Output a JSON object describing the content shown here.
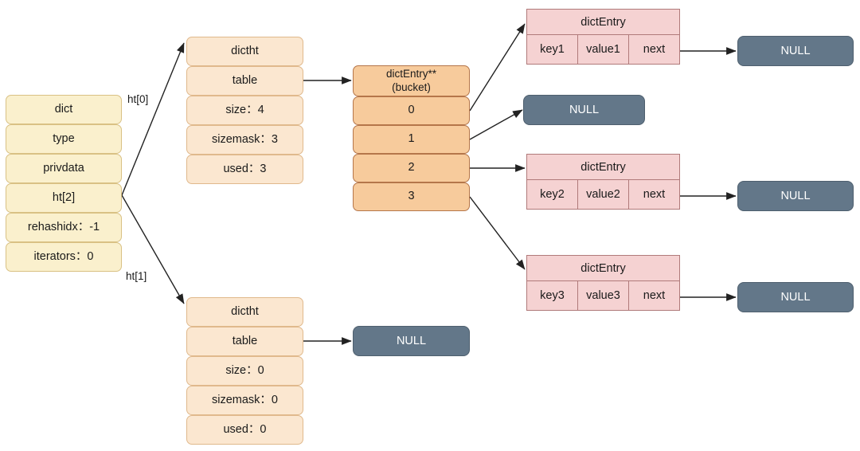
{
  "diagram": {
    "title": "Redis dict / dictht / dictEntry structure",
    "colors": {
      "dict_fill": "#FAF0CD",
      "dictht_fill": "#FBE7D0",
      "bucket_fill": "#F7CB9C",
      "dictentry_fill": "#F5D2D2",
      "null_fill": "#637789",
      "background": "#FFFFFF",
      "edge": "#333333"
    }
  },
  "dict": {
    "rows": [
      {
        "label": "dict"
      },
      {
        "label": "type"
      },
      {
        "label": "privdata"
      },
      {
        "label": "ht[2]"
      },
      {
        "label": "rehashidx：-1"
      },
      {
        "label": "iterators：0"
      }
    ]
  },
  "edge_labels": {
    "ht0": "ht[0]",
    "ht1": "ht[1]"
  },
  "dictht0": {
    "rows": [
      {
        "label": "dictht"
      },
      {
        "label": "table"
      },
      {
        "label": "size：4"
      },
      {
        "label": "sizemask：3"
      },
      {
        "label": "used：3"
      }
    ]
  },
  "dictht1": {
    "rows": [
      {
        "label": "dictht"
      },
      {
        "label": "table"
      },
      {
        "label": "size：0"
      },
      {
        "label": "sizemask：0"
      },
      {
        "label": "used：0"
      }
    ]
  },
  "bucket": {
    "header_line1": "dictEntry**",
    "header_line2": "(bucket)",
    "slots": [
      {
        "label": "0"
      },
      {
        "label": "1"
      },
      {
        "label": "2"
      },
      {
        "label": "3"
      }
    ]
  },
  "entries": [
    {
      "header": "dictEntry",
      "key": "key1",
      "value": "value1",
      "next": "next"
    },
    {
      "header": "dictEntry",
      "key": "key2",
      "value": "value2",
      "next": "next"
    },
    {
      "header": "dictEntry",
      "key": "key3",
      "value": "value3",
      "next": "next"
    }
  ],
  "nulls": [
    {
      "label": "NULL"
    },
    {
      "label": "NULL"
    },
    {
      "label": "NULL"
    },
    {
      "label": "NULL"
    },
    {
      "label": "NULL"
    }
  ]
}
